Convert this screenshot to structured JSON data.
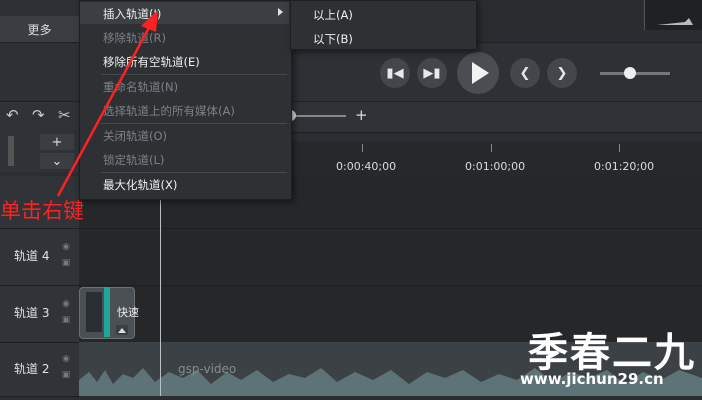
{
  "toolbar": {
    "more_label": "更多"
  },
  "menu": {
    "items": [
      {
        "label": "插入轨道(I)",
        "enabled": true,
        "submenu": true
      },
      {
        "label": "移除轨道(R)",
        "enabled": false
      },
      {
        "label": "移除所有空轨道(E)",
        "enabled": true
      },
      {
        "label": "重命名轨道(N)",
        "enabled": false
      },
      {
        "label": "选择轨道上的所有媒体(A)",
        "enabled": false
      },
      {
        "label": "关闭轨道(O)",
        "enabled": false
      },
      {
        "label": "锁定轨道(L)",
        "enabled": false
      },
      {
        "label": "最大化轨道(X)",
        "enabled": true
      }
    ],
    "submenu_items": [
      {
        "label": "以上(A)"
      },
      {
        "label": "以下(B)"
      }
    ]
  },
  "ruler": {
    "ticks": [
      "0:00:40;00",
      "0:01:00;00",
      "0:01:20;00"
    ]
  },
  "tracks": [
    {
      "label": "轨道 4"
    },
    {
      "label": "轨道 3"
    },
    {
      "label": "轨道 2"
    }
  ],
  "clips": {
    "track3_label": "快速",
    "track2_label": "gsp-video"
  },
  "zoom": {
    "plus": "+"
  },
  "annotation": {
    "text": "单击右键"
  },
  "watermark": {
    "cn": "季春二九",
    "url": "www.jichun29.cn"
  }
}
